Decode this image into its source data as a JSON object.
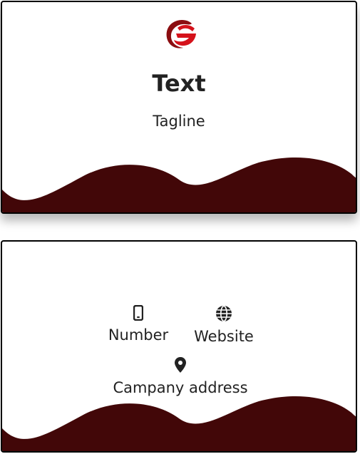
{
  "front": {
    "logo_icon": "company-logo",
    "title": "Text",
    "tagline": "Tagline"
  },
  "back": {
    "number": {
      "icon": "phone-icon",
      "label": "Number"
    },
    "website": {
      "icon": "globe-icon",
      "label": "Website"
    },
    "address": {
      "icon": "location-pin-icon",
      "label": "Campany address"
    }
  },
  "colors": {
    "wave": "#420708",
    "logo_red": "#d5121b",
    "logo_dark": "#8b0d10",
    "text": "#222222",
    "border": "#000000"
  }
}
